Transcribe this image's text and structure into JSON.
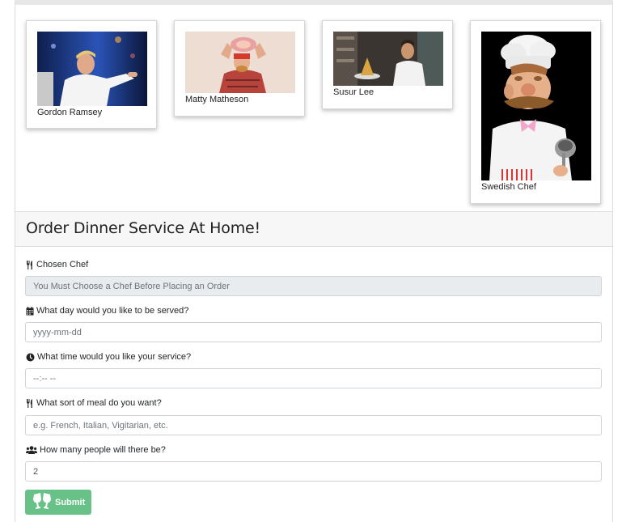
{
  "chefs": [
    {
      "name": "Gordon Ramsey",
      "bg": "#1d3a7a"
    },
    {
      "name": "Matty Matheson",
      "bg": "#eeddd3"
    },
    {
      "name": "Susur Lee",
      "bg": "#3a3530"
    },
    {
      "name": "Swedish Chef",
      "bg": "#000000"
    }
  ],
  "order": {
    "title": "Order Dinner Service At Home!",
    "chosen_chef_label": "Chosen Chef",
    "chosen_chef_value": "You Must Choose a Chef Before Placing an Order",
    "date_label": "What day would you like to be served?",
    "date_placeholder": "yyyy-mm-dd",
    "time_label": "What time would you like your service?",
    "time_placeholder": "--:-- --",
    "meal_label": "What sort of meal do you want?",
    "meal_placeholder": "e.g. French, Italian, Vigitarian, etc.",
    "people_label": "How many people will there be?",
    "people_value": "2",
    "submit_label": "Submit"
  },
  "colors": {
    "submit_bg": "#68c287",
    "readonly_bg": "#e9ecef",
    "header_bg": "#f7f7f7"
  },
  "icons": {
    "chef": "utensils-icon",
    "date": "calendar-icon",
    "time": "clock-icon",
    "meal": "utensils-icon",
    "people": "users-icon",
    "submit": "champagne-glasses-icon"
  }
}
